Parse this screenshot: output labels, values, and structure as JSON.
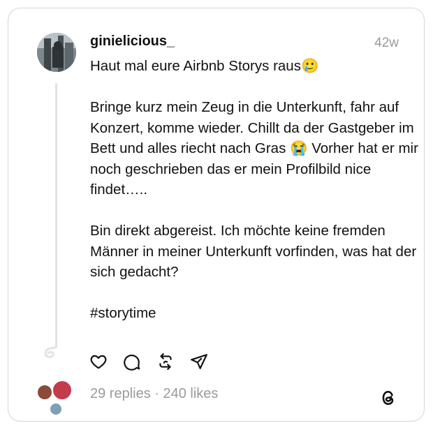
{
  "post": {
    "username": "ginielicious_",
    "timestamp": "42w",
    "text": "Haut mal eure Airbnb Storys raus🥲\n\nBringe kurz mein Zeug in die Unterkunft, fahr auf Konzert, komme wieder. Chillt da der Gastgeber im Bett und alles riecht nach Gras 😭 Vorher hat er mir noch geschrieben das er mein Profilbild nice findet…..\n\nBin direkt abgereist. Ich möchte keine fremden Männer in meiner Unterkunft vorfinden, was hat der sich gedacht?\n\n#storytime"
  },
  "stats": {
    "text": "29 replies · 240 likes"
  },
  "actions": [
    {
      "icon": "heart-icon"
    },
    {
      "icon": "comment-icon"
    },
    {
      "icon": "repost-icon"
    },
    {
      "icon": "share-icon"
    }
  ],
  "colors": {
    "text": "#111111",
    "muted": "#9a9a9a",
    "border": "#d6d6d6"
  }
}
